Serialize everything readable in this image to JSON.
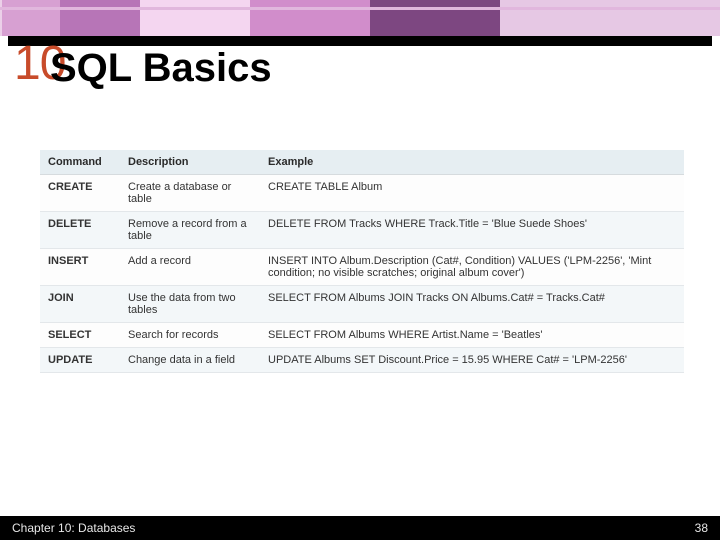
{
  "chapter_number": "10",
  "title": "SQL Basics",
  "table": {
    "headers": {
      "command": "Command",
      "description": "Description",
      "example": "Example"
    },
    "rows": [
      {
        "command": "CREATE",
        "description": "Create a database or table",
        "example": "CREATE TABLE Album"
      },
      {
        "command": "DELETE",
        "description": "Remove a record from a table",
        "example": "DELETE FROM Tracks WHERE Track.Title = 'Blue Suede Shoes'"
      },
      {
        "command": "INSERT",
        "description": "Add a record",
        "example": "INSERT INTO Album.Description (Cat#, Condition) VALUES ('LPM-2256', 'Mint condition; no visible scratches; original album cover')"
      },
      {
        "command": "JOIN",
        "description": "Use the data from two tables",
        "example": "SELECT FROM Albums JOIN Tracks ON Albums.Cat# = Tracks.Cat#"
      },
      {
        "command": "SELECT",
        "description": "Search for records",
        "example": "SELECT FROM Albums WHERE Artist.Name = 'Beatles'"
      },
      {
        "command": "UPDATE",
        "description": "Change data in a field",
        "example": "UPDATE Albums SET Discount.Price = 15.95 WHERE Cat# = 'LPM-2256'"
      }
    ]
  },
  "footer": {
    "left": "Chapter 10: Databases",
    "right": "38"
  }
}
